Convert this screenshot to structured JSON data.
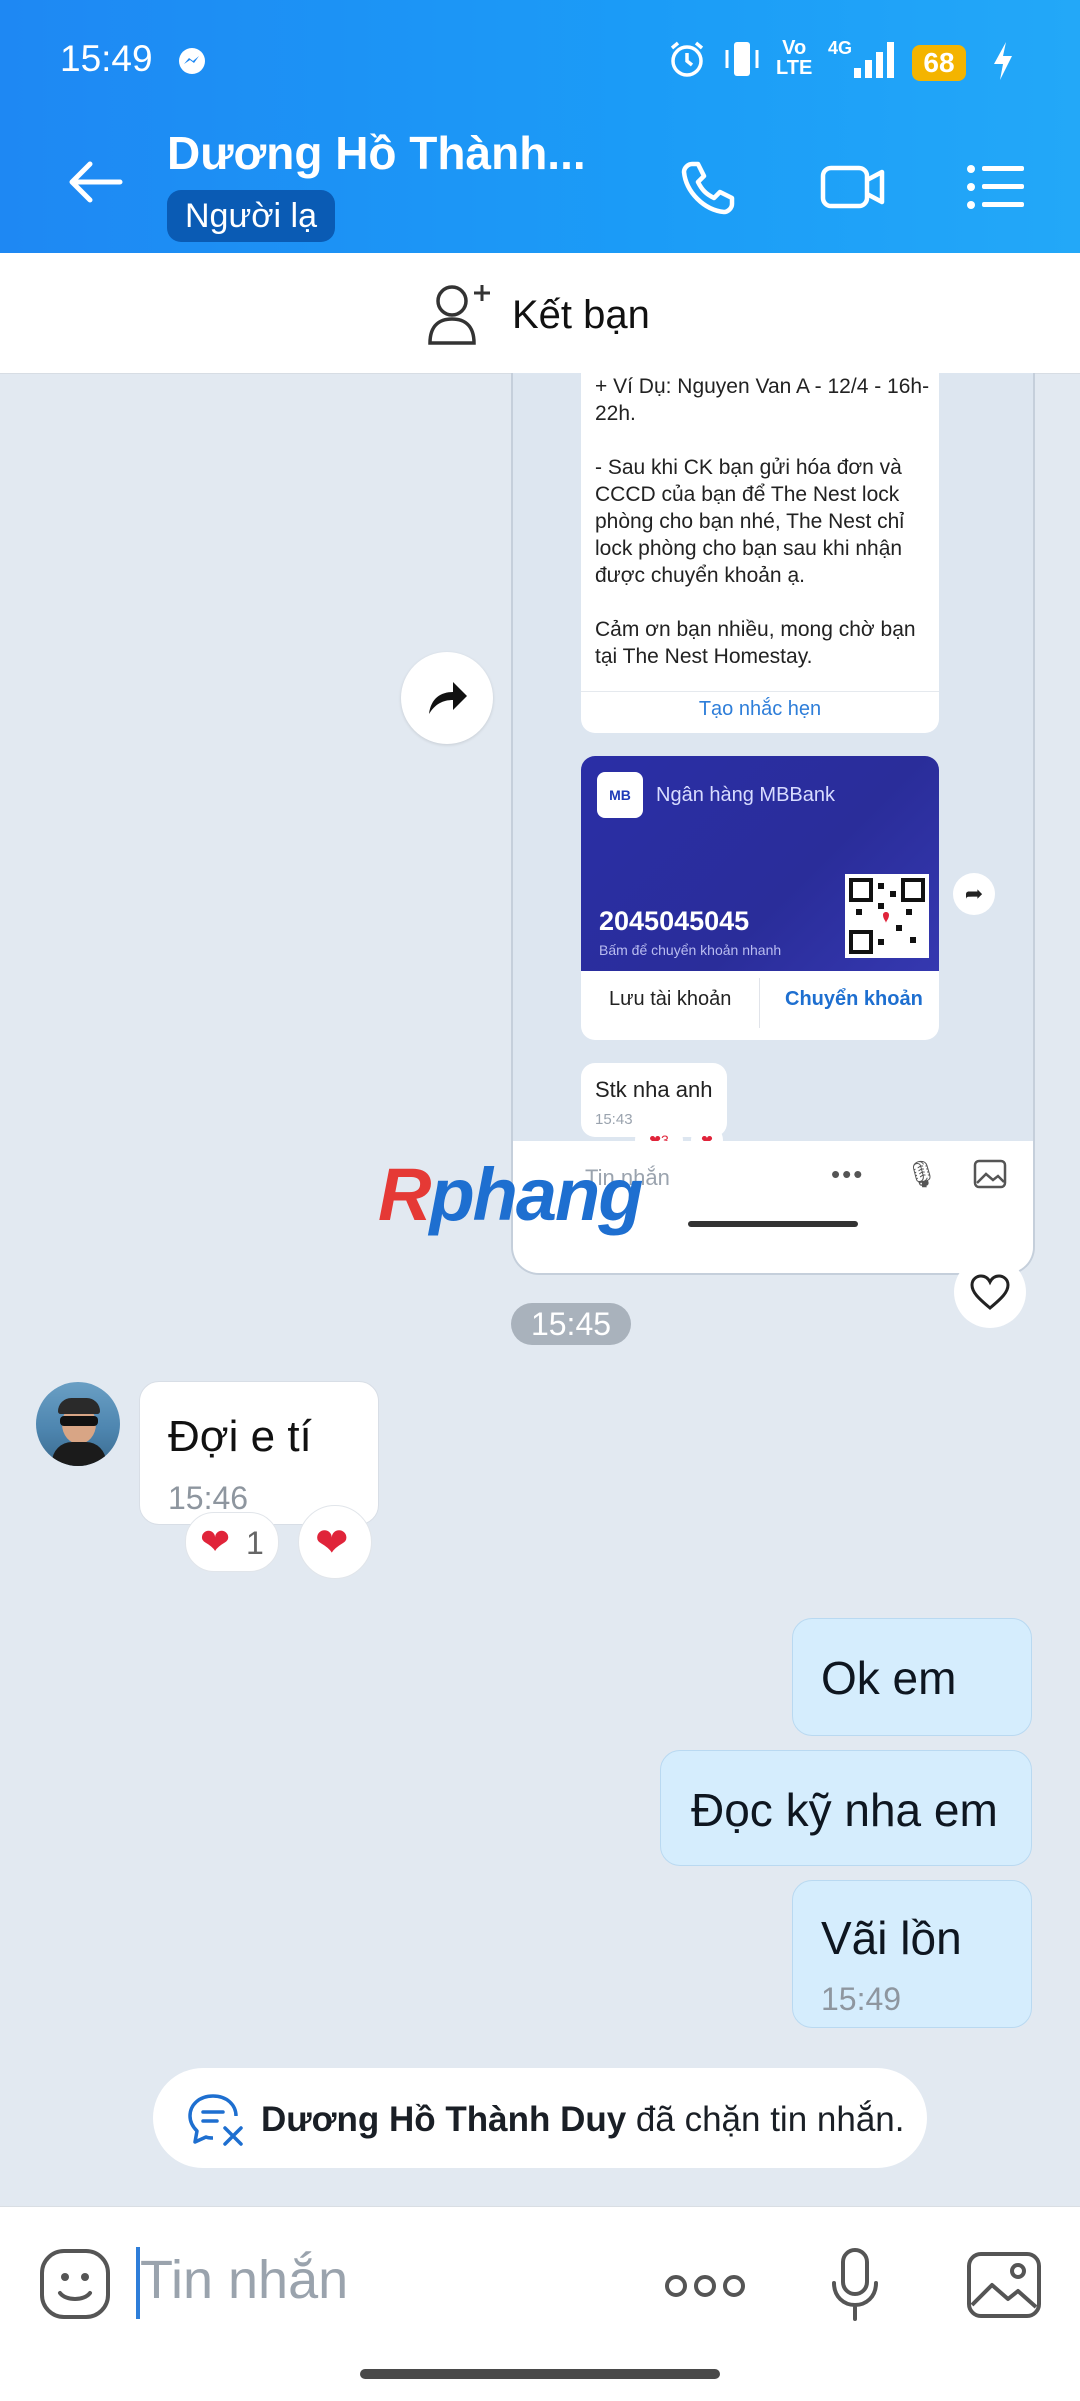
{
  "status_bar": {
    "time": "15:49",
    "network_label_top": "Vo",
    "network_label_bottom": "LTE",
    "net_type": "4G",
    "battery": "68"
  },
  "header": {
    "contact_name": "Dương Hồ Thành...",
    "badge": "Người lạ"
  },
  "add_friend": {
    "label": "Kết bạn"
  },
  "embedded_screenshot": {
    "instructions_text": "+ Ví Dụ: Nguyen Van A  - 12/4 - 16h-22h.\n\n- Sau khi CK bạn gửi hóa đơn và CCCD của bạn để The Nest lock phòng cho bạn nhé, The Nest chỉ lock phòng cho bạn sau khi nhận được chuyển khoản ạ.\n\nCảm ơn bạn nhiều, mong chờ bạn tại The Nest Homestay.",
    "reminder_link": "Tạo nhắc hẹn",
    "bank": {
      "logo": "MB",
      "bank_name": "Ngân hàng MBBank",
      "account_number": "2045045045",
      "hint": "Bấm để chuyển khoản nhanh",
      "save_label": "Lưu tài khoản",
      "transfer_label": "Chuyển khoản"
    },
    "message": {
      "text": "Stk nha anh",
      "time": "15:43"
    },
    "reaction_count": "3",
    "input_placeholder": "Tin nhắn"
  },
  "watermark": "Rphang",
  "time_divider": "15:45",
  "incoming": {
    "text": "Đợi e tí",
    "time": "15:46",
    "reaction_count": "1"
  },
  "outgoing": [
    {
      "text": "Ok em"
    },
    {
      "text": "Đọc kỹ nha em"
    },
    {
      "text": "Vãi lồn",
      "time": "15:49"
    }
  ],
  "blocked_notice": {
    "name": "Dương Hồ Thành Duy",
    "suffix": " đã chặn tin nhắn."
  },
  "composer": {
    "placeholder": "Tin nhắn"
  },
  "colors": {
    "header_blue": "#1e88f3",
    "bubble_out": "#d5edfd",
    "heart_red": "#e0243a",
    "link_blue": "#2e7ed9"
  }
}
